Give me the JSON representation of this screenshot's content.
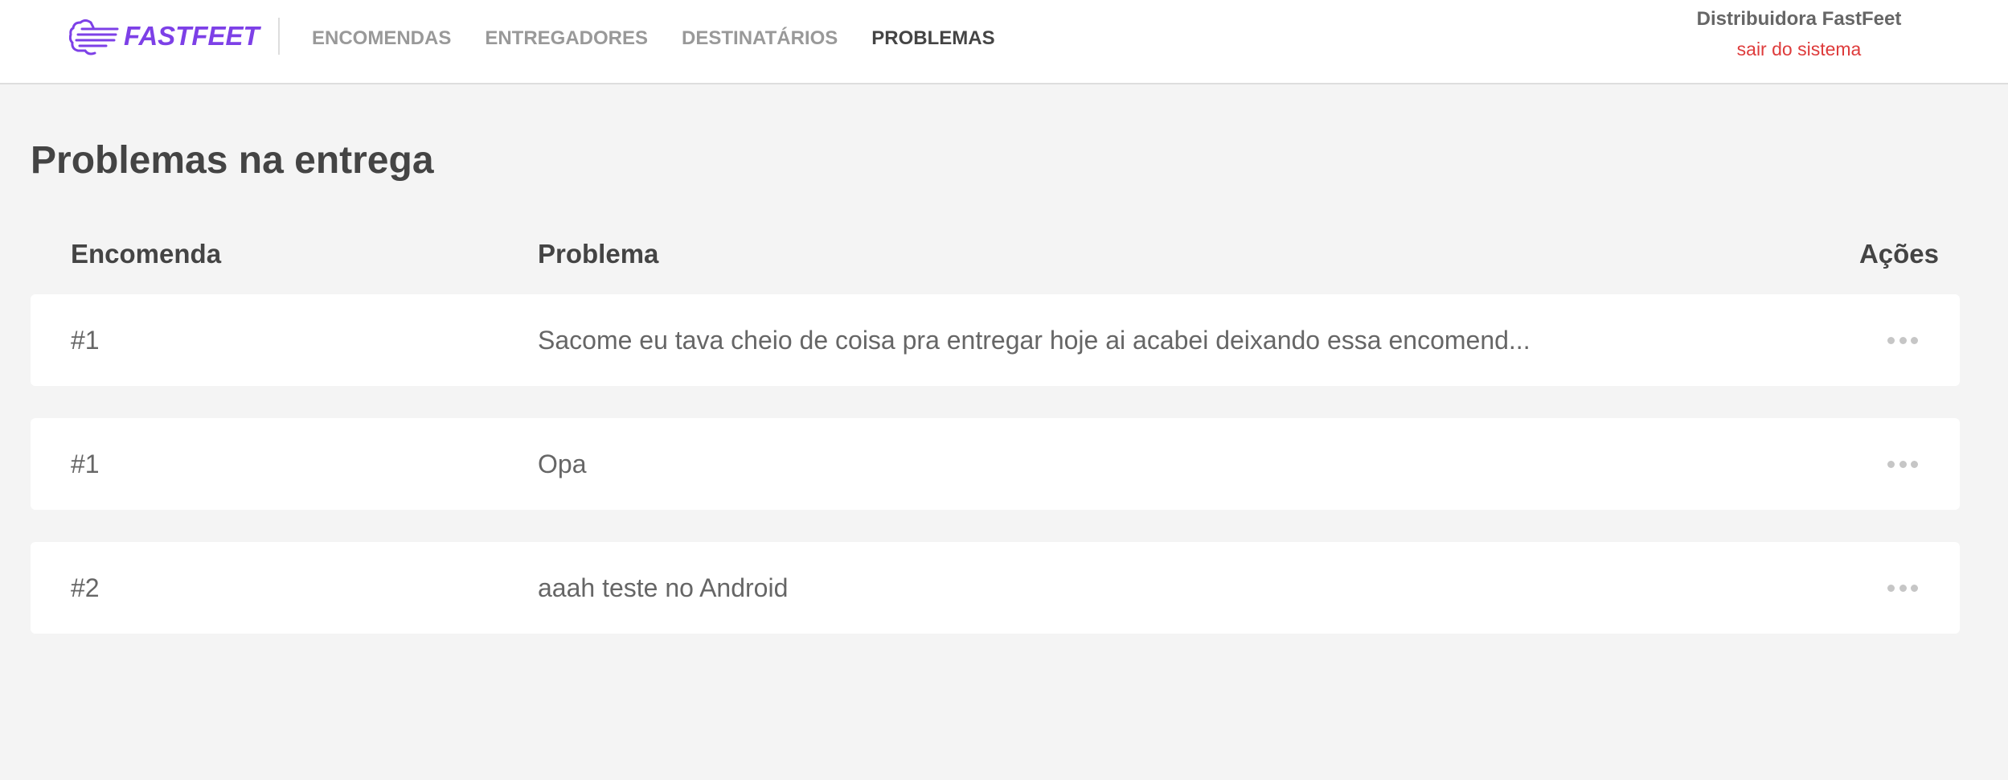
{
  "header": {
    "brand": "FASTFEET",
    "nav": [
      {
        "label": "ENCOMENDAS",
        "active": false
      },
      {
        "label": "ENTREGADORES",
        "active": false
      },
      {
        "label": "DESTINATÁRIOS",
        "active": false
      },
      {
        "label": "PROBLEMAS",
        "active": true
      }
    ],
    "user_name": "Distribuidora FastFeet",
    "logout_label": "sair do sistema"
  },
  "main": {
    "title": "Problemas na entrega",
    "columns": {
      "order": "Encomenda",
      "problem": "Problema",
      "actions": "Ações"
    },
    "rows": [
      {
        "order": "#1",
        "problem": "Sacome eu tava cheio de coisa pra entregar hoje ai acabei deixando essa encomend..."
      },
      {
        "order": "#1",
        "problem": "Opa"
      },
      {
        "order": "#2",
        "problem": "aaah teste no Android"
      }
    ]
  },
  "icons": {
    "logo": "fastfeet-truck-icon",
    "row_actions": "more-horizontal-icon"
  },
  "colors": {
    "brand": "#7d40e7",
    "logout": "#de3b3b",
    "background": "#f4f4f4",
    "nav_inactive": "#999999",
    "nav_active": "#444444"
  }
}
